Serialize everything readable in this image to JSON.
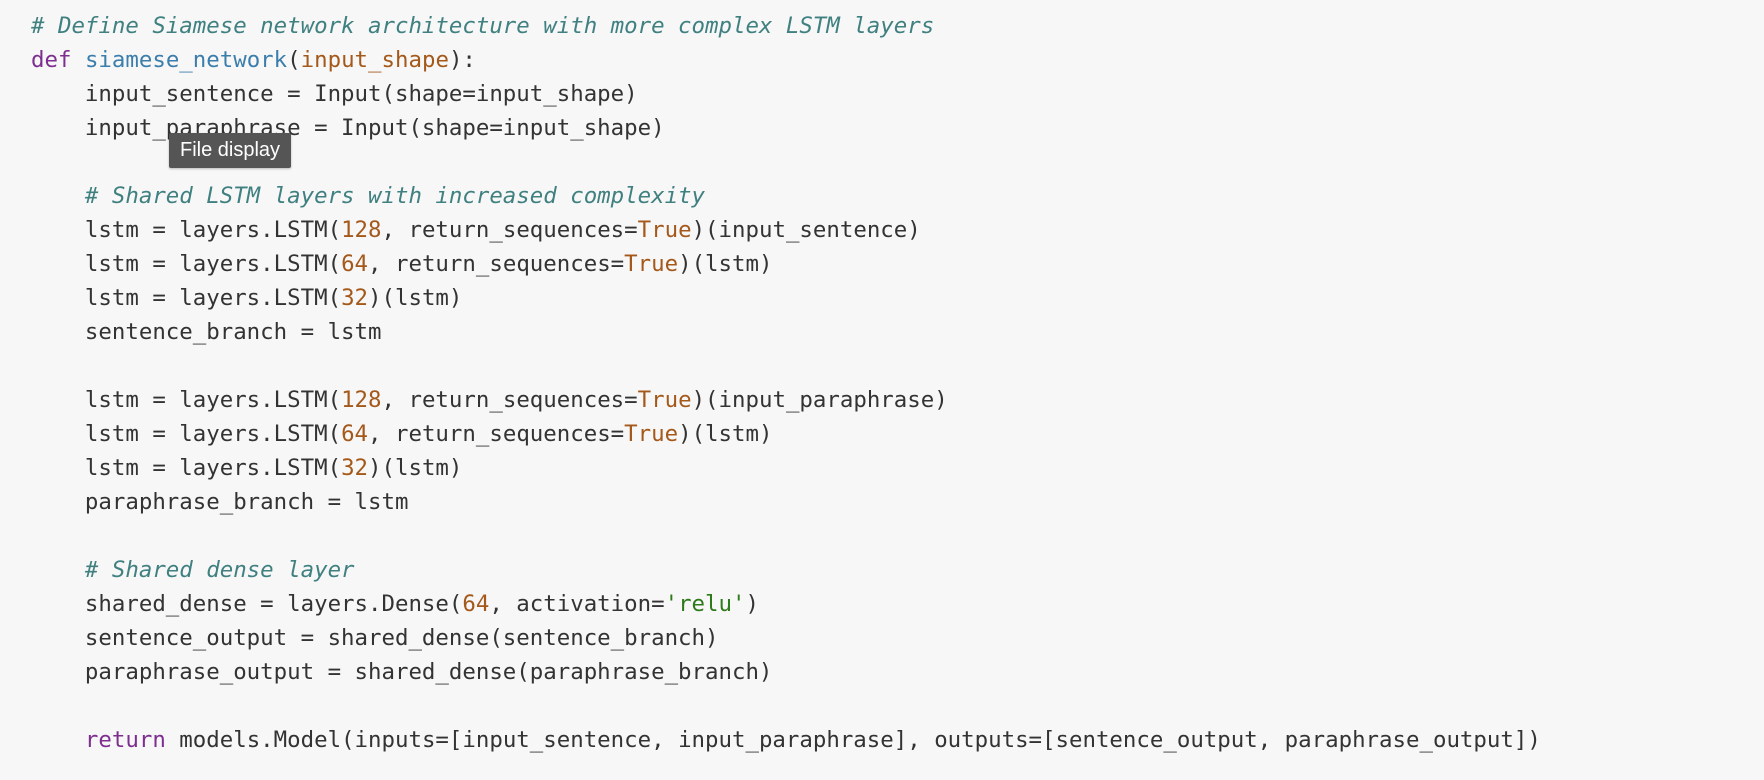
{
  "tooltip": {
    "text": "File display"
  },
  "code": {
    "l1": {
      "comment": "# Define Siamese network architecture with more complex LSTM layers"
    },
    "l2": {
      "def": "def",
      "sp": " ",
      "fname": "siamese_network",
      "open": "(",
      "param": "input_shape",
      "close": "):"
    },
    "l3": {
      "text": "    input_sentence = Input(shape=input_shape)"
    },
    "l4": {
      "text": "    input_paraphrase = Input(shape=input_shape)"
    },
    "l5": {
      "text": ""
    },
    "l6": {
      "indent": "    ",
      "comment": "# Shared LSTM layers with increased complexity"
    },
    "l7": {
      "a": "    lstm = layers.LSTM(",
      "n": "128",
      "b": ", return_sequences=",
      "t": "True",
      "c": ")(input_sentence)"
    },
    "l8": {
      "a": "    lstm = layers.LSTM(",
      "n": "64",
      "b": ", return_sequences=",
      "t": "True",
      "c": ")(lstm)"
    },
    "l9": {
      "a": "    lstm = layers.LSTM(",
      "n": "32",
      "c": ")(lstm)"
    },
    "l10": {
      "text": "    sentence_branch = lstm"
    },
    "l11": {
      "text": ""
    },
    "l12": {
      "a": "    lstm = layers.LSTM(",
      "n": "128",
      "b": ", return_sequences=",
      "t": "True",
      "c": ")(input_paraphrase)"
    },
    "l13": {
      "a": "    lstm = layers.LSTM(",
      "n": "64",
      "b": ", return_sequences=",
      "t": "True",
      "c": ")(lstm)"
    },
    "l14": {
      "a": "    lstm = layers.LSTM(",
      "n": "32",
      "c": ")(lstm)"
    },
    "l15": {
      "text": "    paraphrase_branch = lstm"
    },
    "l16": {
      "text": ""
    },
    "l17": {
      "indent": "    ",
      "comment": "# Shared dense layer"
    },
    "l18": {
      "a": "    shared_dense = layers.Dense(",
      "n": "64",
      "b": ", activation=",
      "s": "'relu'",
      "c": ")"
    },
    "l19": {
      "text": "    sentence_output = shared_dense(sentence_branch)"
    },
    "l20": {
      "text": "    paraphrase_output = shared_dense(paraphrase_branch)"
    },
    "l21": {
      "text": ""
    },
    "l22": {
      "indent": "    ",
      "kw": "return",
      "rest": " models.Model(inputs=[input_sentence, input_paraphrase], outputs=[sentence_output, paraphrase_output])"
    }
  },
  "colors": {
    "background": "#f7f7f7",
    "comment": "#408080",
    "keyword": "#7e2e8f",
    "function_name": "#3b7eab",
    "number": "#a4591b",
    "string": "#2d7a1a",
    "tooltip_bg": "#555555"
  }
}
